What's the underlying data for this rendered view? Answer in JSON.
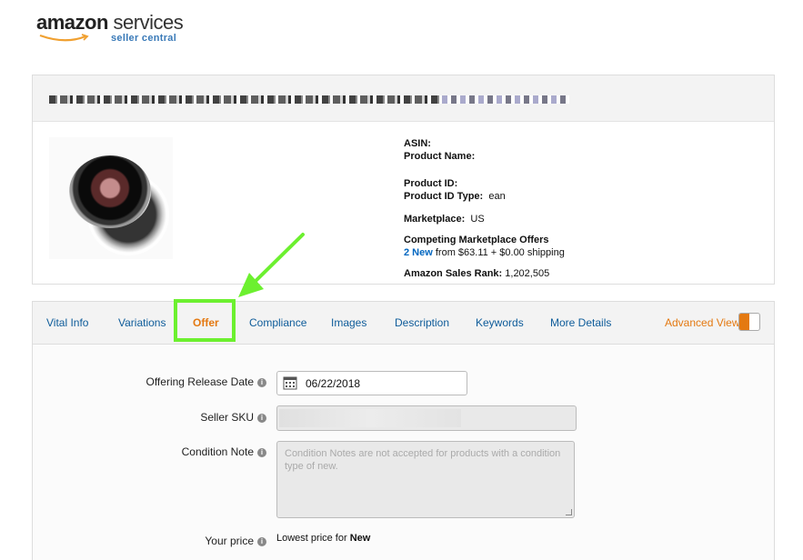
{
  "logo": {
    "brand": "amazon",
    "brand_suffix": " services",
    "sub": "seller central"
  },
  "product": {
    "asin_label": "ASIN:",
    "name_label": "Product Name:",
    "id_label": "Product ID:",
    "id_type_label": "Product ID Type:",
    "id_type_value": "ean",
    "marketplace_label": "Marketplace:",
    "marketplace_value": "US",
    "offers_label": "Competing Marketplace Offers",
    "offers_link": "2 New",
    "offers_text": " from $63.11  + $0.00 shipping",
    "rank_label": "Amazon Sales Rank:",
    "rank_value": "1,202,505"
  },
  "tabs": [
    {
      "label": "Vital Info"
    },
    {
      "label": "Variations"
    },
    {
      "label": "Offer",
      "active": true
    },
    {
      "label": "Compliance"
    },
    {
      "label": "Images"
    },
    {
      "label": "Description"
    },
    {
      "label": "Keywords"
    },
    {
      "label": "More Details"
    }
  ],
  "advanced_view": "Advanced View",
  "form": {
    "release_label": "Offering Release Date",
    "release_value": "06/22/2018",
    "sku_label": "Seller SKU",
    "condition_label": "Condition Note",
    "condition_placeholder": "Condition Notes are not accepted for products with a condition type of new.",
    "price_label": "Your price",
    "price_hint_prefix": "Lowest price for ",
    "price_hint_bold": "New"
  },
  "colors": {
    "accent": "#e47911",
    "link": "#0e5c9a",
    "highlight": "#6cf02f"
  },
  "icons": {
    "info": "info-icon",
    "calendar": "calendar-icon",
    "arrow": "pointer-arrow"
  }
}
